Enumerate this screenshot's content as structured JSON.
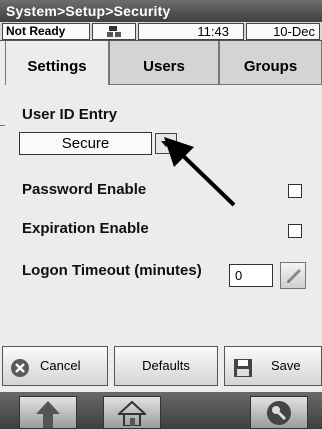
{
  "title": "System>Setup>Security",
  "status": {
    "mode": "Not Ready",
    "network_icon": "network-icon",
    "time": "11:43",
    "date": "10-Dec"
  },
  "tabs": [
    {
      "label": "Settings",
      "active": true
    },
    {
      "label": "Users",
      "active": false
    },
    {
      "label": "Groups",
      "active": false
    }
  ],
  "settings": {
    "user_id_entry_label": "User ID Entry",
    "user_id_entry_value": "Secure",
    "password_enable_label": "Password Enable",
    "password_enable_checked": false,
    "expiration_enable_label": "Expiration Enable",
    "expiration_enable_checked": false,
    "logon_timeout_label": "Logon Timeout (minutes)",
    "logon_timeout_value": "0"
  },
  "buttons": {
    "cancel": "Cancel",
    "defaults": "Defaults",
    "save": "Save"
  },
  "nav": {
    "icons": [
      "up-arrow-icon",
      "home-icon",
      "service-wrench-icon"
    ]
  },
  "colors": {
    "title_bar": "#4d4d4d",
    "background": "#ececec",
    "button_face": "#e8e8e8"
  }
}
